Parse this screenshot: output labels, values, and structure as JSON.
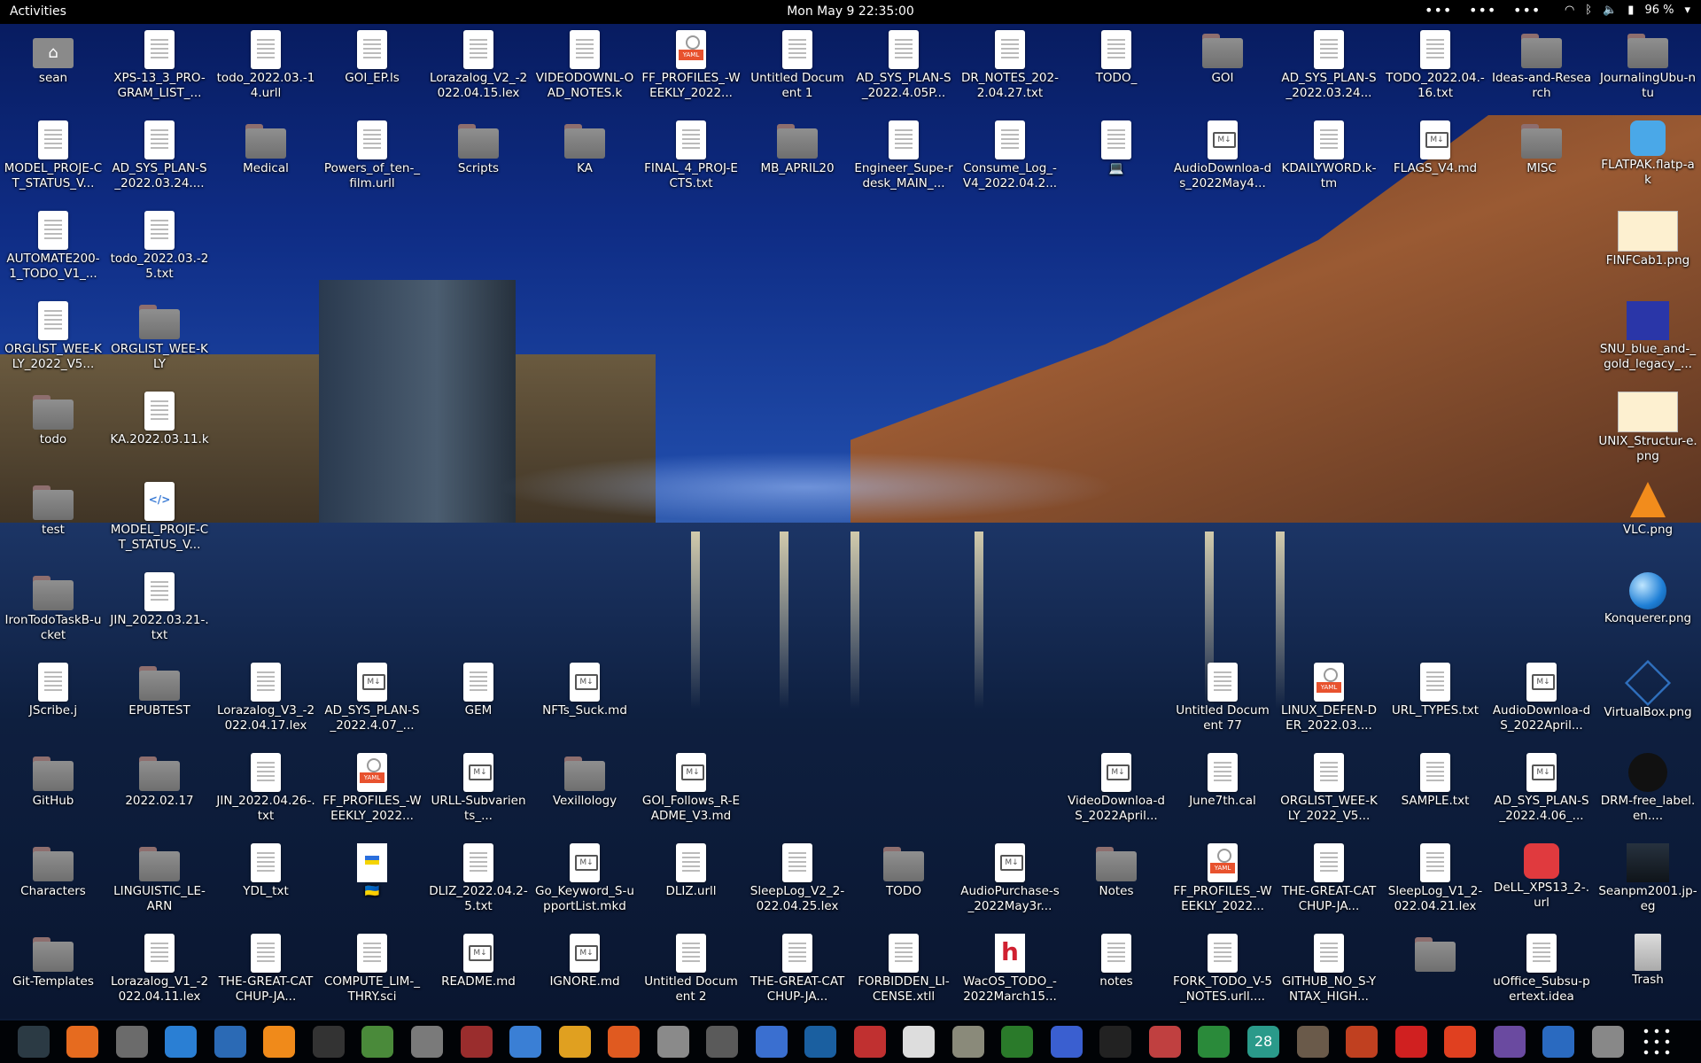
{
  "topbar": {
    "activities": "Activities",
    "clock": "Mon May 9  22:35:00",
    "battery": "96 %"
  },
  "desktop_icons": [
    {
      "id": "sean",
      "label": "sean",
      "kind": "home"
    },
    {
      "id": "xps",
      "label": "XPS-13_3_PRO-GRAM_LIST_...",
      "kind": "doc"
    },
    {
      "id": "todo1",
      "label": "todo_2022.03.-14.urll",
      "kind": "doc"
    },
    {
      "id": "goiep",
      "label": "GOI_EP.ls",
      "kind": "doc"
    },
    {
      "id": "lorav2",
      "label": "Lorazalog_V2_-2022.04.15.lex",
      "kind": "doc"
    },
    {
      "id": "videodl",
      "label": "VIDEODOWNL-OAD_NOTES.k",
      "kind": "doc"
    },
    {
      "id": "ffprof1",
      "label": "FF_PROFILES_-WEEKLY_2022...",
      "kind": "yaml"
    },
    {
      "id": "untitled1",
      "label": "Untitled Document 1",
      "kind": "doc"
    },
    {
      "id": "adsys1",
      "label": "AD_SYS_PLAN-S_2022.4.05P...",
      "kind": "doc"
    },
    {
      "id": "drnotes",
      "label": "DR_NOTES_202-2.04.27.txt",
      "kind": "doc"
    },
    {
      "id": "todo_",
      "label": "TODO_",
      "kind": "doc"
    },
    {
      "id": "goi",
      "label": "GOI",
      "kind": "folder"
    },
    {
      "id": "adsys2",
      "label": "AD_SYS_PLAN-S_2022.03.24...",
      "kind": "doc"
    },
    {
      "id": "todo2",
      "label": "TODO_2022.04.-16.txt",
      "kind": "doc"
    },
    {
      "id": "ideas",
      "label": "Ideas-and-Research",
      "kind": "folder"
    },
    {
      "id": "journal",
      "label": "JournalingUbu-ntu",
      "kind": "folder"
    },
    {
      "id": "model1",
      "label": "MODEL_PROJE-CT_STATUS_V...",
      "kind": "doc"
    },
    {
      "id": "adsys3",
      "label": "AD_SYS_PLAN-S_2022.03.24....",
      "kind": "doc"
    },
    {
      "id": "medical",
      "label": "Medical",
      "kind": "folder"
    },
    {
      "id": "powers",
      "label": "Powers_of_ten-_film.urll",
      "kind": "doc"
    },
    {
      "id": "scripts",
      "label": "Scripts",
      "kind": "folder"
    },
    {
      "id": "ka",
      "label": "KA",
      "kind": "folder"
    },
    {
      "id": "final4",
      "label": "FINAL_4_PROJ-ECTS.txt",
      "kind": "doc"
    },
    {
      "id": "mbapril",
      "label": "MB_APRIL20",
      "kind": "folder"
    },
    {
      "id": "engineer",
      "label": "Engineer_Supe-rdesk_MAIN_...",
      "kind": "doc"
    },
    {
      "id": "consume",
      "label": "Consume_Log_-V4_2022.04.2...",
      "kind": "doc"
    },
    {
      "id": "laptop",
      "label": "💻",
      "kind": "doc"
    },
    {
      "id": "audiodl1",
      "label": "AudioDownloa-ds_2022May4...",
      "kind": "md"
    },
    {
      "id": "kdaily",
      "label": "KDAILYWORD.k-tm",
      "kind": "doc"
    },
    {
      "id": "flags",
      "label": "FLAGS_V4.md",
      "kind": "md"
    },
    {
      "id": "misc",
      "label": "MISC",
      "kind": "folder"
    },
    {
      "id": "flatpak",
      "label": "FLATPAK.flatp-ak",
      "kind": "blue"
    },
    {
      "id": "automate",
      "label": "AUTOMATE200-1_TODO_V1_...",
      "kind": "doc"
    },
    {
      "id": "todo3",
      "label": "todo_2022.03.-25.txt",
      "kind": "doc"
    },
    {
      "id": "finfcab",
      "label": "FINFCab1.png",
      "kind": "image"
    },
    {
      "id": "orglist1",
      "label": "ORGLIST_WEE-KLY_2022_V5...",
      "kind": "doc"
    },
    {
      "id": "orglist2",
      "label": "ORGLIST_WEE-KLY",
      "kind": "folder"
    },
    {
      "id": "snu",
      "label": "SNU_blue_and-_gold_legacy_...",
      "kind": "snu"
    },
    {
      "id": "todofolder",
      "label": "todo",
      "kind": "folder"
    },
    {
      "id": "ka2",
      "label": "KA.2022.03.11.k",
      "kind": "doc"
    },
    {
      "id": "unix",
      "label": "UNIX_Structur-e.png",
      "kind": "image"
    },
    {
      "id": "test",
      "label": "test",
      "kind": "folder"
    },
    {
      "id": "model2",
      "label": "MODEL_PROJE-CT_STATUS_V...",
      "kind": "xml"
    },
    {
      "id": "vlc",
      "label": "VLC.png",
      "kind": "cone"
    },
    {
      "id": "irontodo",
      "label": "IronTodoTaskB-ucket",
      "kind": "folder"
    },
    {
      "id": "jin1",
      "label": "JIN_2022.03.21-.txt",
      "kind": "doc"
    },
    {
      "id": "konq",
      "label": "Konquerer.png",
      "kind": "globe"
    },
    {
      "id": "jscribe",
      "label": "JScribe.j",
      "kind": "doc"
    },
    {
      "id": "epubtest",
      "label": "EPUBTEST",
      "kind": "folder"
    },
    {
      "id": "lorav3",
      "label": "Lorazalog_V3_-2022.04.17.lex",
      "kind": "doc"
    },
    {
      "id": "adsys4",
      "label": "AD_SYS_PLAN-S_2022.4.07_...",
      "kind": "md"
    },
    {
      "id": "gem",
      "label": "GEM",
      "kind": "doc"
    },
    {
      "id": "nfts",
      "label": "NFTs_Suck.md",
      "kind": "md"
    },
    {
      "id": "untitled77",
      "label": "Untitled Document 77",
      "kind": "doc"
    },
    {
      "id": "linuxdef",
      "label": "LINUX_DEFEN-DER_2022.03....",
      "kind": "yaml"
    },
    {
      "id": "urltypes",
      "label": "URL_TYPES.txt",
      "kind": "doc"
    },
    {
      "id": "audiodl2",
      "label": "AudioDownloa-dS_2022April...",
      "kind": "md"
    },
    {
      "id": "vbox",
      "label": "VirtualBox.png",
      "kind": "vbox"
    },
    {
      "id": "github",
      "label": "GitHub",
      "kind": "folder"
    },
    {
      "id": "d20220217",
      "label": "2022.02.17",
      "kind": "folder"
    },
    {
      "id": "jin2",
      "label": "JIN_2022.04.26-.txt",
      "kind": "doc"
    },
    {
      "id": "ffprof2",
      "label": "FF_PROFILES_-WEEKLY_2022...",
      "kind": "yaml"
    },
    {
      "id": "urll",
      "label": "URLL-Subvarients_...",
      "kind": "md"
    },
    {
      "id": "vexil",
      "label": "Vexillology",
      "kind": "folder"
    },
    {
      "id": "goifollows",
      "label": "GOI_Follows_R-EADME_V3.md",
      "kind": "md"
    },
    {
      "id": "videodl2",
      "label": "VideoDownloa-dS_2022April...",
      "kind": "md"
    },
    {
      "id": "june7",
      "label": "June7th.cal",
      "kind": "doc"
    },
    {
      "id": "orglist3",
      "label": "ORGLIST_WEE-KLY_2022_V5...",
      "kind": "doc"
    },
    {
      "id": "sample",
      "label": "SAMPLE.txt",
      "kind": "doc"
    },
    {
      "id": "adsys5",
      "label": "AD_SYS_PLAN-S_2022.4.06_...",
      "kind": "md"
    },
    {
      "id": "drm",
      "label": "DRM-free_label.en....",
      "kind": "drm"
    },
    {
      "id": "characters",
      "label": "Characters",
      "kind": "folder"
    },
    {
      "id": "linguistic",
      "label": "LINGUISTIC_LE-ARN",
      "kind": "folder"
    },
    {
      "id": "ydl",
      "label": "YDL_txt",
      "kind": "doc"
    },
    {
      "id": "ukraine",
      "label": "🇺🇦",
      "kind": "sunflower"
    },
    {
      "id": "dliz1",
      "label": "DLIZ_2022.04.2-5.txt",
      "kind": "doc"
    },
    {
      "id": "gokeyword",
      "label": "Go_Keyword_S-upportList.mkd",
      "kind": "md"
    },
    {
      "id": "dlizurll",
      "label": "DLIZ.urll",
      "kind": "doc"
    },
    {
      "id": "sleepv2",
      "label": "SleepLog_V2_2-022.04.25.lex",
      "kind": "doc"
    },
    {
      "id": "todofolder2",
      "label": "TODO",
      "kind": "folder"
    },
    {
      "id": "audiopurch",
      "label": "AudioPurchase-s_2022May3r...",
      "kind": "md"
    },
    {
      "id": "notesfolder",
      "label": "Notes",
      "kind": "folder"
    },
    {
      "id": "ffprof3",
      "label": "FF_PROFILES_-WEEKLY_2022...",
      "kind": "yaml"
    },
    {
      "id": "greatcatch1",
      "label": "THE-GREAT-CATCHUP-JA...",
      "kind": "doc"
    },
    {
      "id": "sleepv1",
      "label": "SleepLog_V1_2-022.04.21.lex",
      "kind": "doc"
    },
    {
      "id": "dellxps",
      "label": "DeLL_XPS13_2-.url",
      "kind": "red"
    },
    {
      "id": "seanpm",
      "label": "Seanpm2001.jp-eg",
      "kind": "photo"
    },
    {
      "id": "gittemplates",
      "label": "Git-Templates",
      "kind": "folder"
    },
    {
      "id": "lorav1",
      "label": "Lorazalog_V1_-2022.04.11.lex",
      "kind": "doc"
    },
    {
      "id": "greatcatch2",
      "label": "THE-GREAT-CATCHUP-JA...",
      "kind": "doc"
    },
    {
      "id": "compute",
      "label": "COMPUTE_LIM-_THRY.sci",
      "kind": "doc"
    },
    {
      "id": "readme",
      "label": "README.md",
      "kind": "md"
    },
    {
      "id": "ignore",
      "label": "IGNORE.md",
      "kind": "md"
    },
    {
      "id": "untitled2",
      "label": "Untitled Document 2",
      "kind": "doc"
    },
    {
      "id": "greatcatch3",
      "label": "THE-GREAT-CATCHUP-JA...",
      "kind": "doc"
    },
    {
      "id": "forbidden",
      "label": "FORBIDDEN_LI-CENSE.xtll",
      "kind": "doc"
    },
    {
      "id": "wacos",
      "label": "WacOS_TODO_-2022March15...",
      "kind": "h"
    },
    {
      "id": "notes",
      "label": "notes",
      "kind": "doc"
    },
    {
      "id": "forktodo",
      "label": "FORK_TODO_V-5_NOTES.urll....",
      "kind": "doc"
    },
    {
      "id": "githubno",
      "label": "GITHUB_NO_S-YNTAX_HIGH...",
      "kind": "doc"
    },
    {
      "id": "pencilfolder",
      "label": "",
      "kind": "folder"
    },
    {
      "id": "uoffice",
      "label": "uOffice_Subsu-pertext.idea",
      "kind": "doc"
    },
    {
      "id": "trash",
      "label": "Trash",
      "kind": "trash"
    }
  ],
  "dock": {
    "apps": [
      {
        "name": "system-monitor",
        "color": "#2b3a44"
      },
      {
        "name": "firefox",
        "color": "#e66b1f"
      },
      {
        "name": "settings",
        "color": "#6b6b6b"
      },
      {
        "name": "help",
        "color": "#2a7fd4"
      },
      {
        "name": "writer",
        "color": "#2b6ab5"
      },
      {
        "name": "vlc",
        "color": "#f08a1a"
      },
      {
        "name": "terminal",
        "color": "#333333"
      },
      {
        "name": "gnome-mahjongg",
        "color": "#4a8a3a"
      },
      {
        "name": "image-viewer",
        "color": "#7a7a7a"
      },
      {
        "name": "monitor-graph",
        "color": "#9a2d2d"
      },
      {
        "name": "text-editor",
        "color": "#3a7fd5"
      },
      {
        "name": "calculator",
        "color": "#e0a020"
      },
      {
        "name": "software-center",
        "color": "#e05a20"
      },
      {
        "name": "files",
        "color": "#8a8a8a"
      },
      {
        "name": "disk-utility",
        "color": "#5a5a5a"
      },
      {
        "name": "todo",
        "color": "#3a6fd0"
      },
      {
        "name": "dictionary",
        "color": "#1a5fa0"
      },
      {
        "name": "document-scanner",
        "color": "#c03030"
      },
      {
        "name": "character-map",
        "color": "#dddddd"
      },
      {
        "name": "archive-manager",
        "color": "#8a8a7a"
      },
      {
        "name": "vim",
        "color": "#2a7a2a"
      },
      {
        "name": "screenshot",
        "color": "#3a5fd0"
      },
      {
        "name": "music",
        "color": "#222222"
      },
      {
        "name": "document-viewer",
        "color": "#c04040"
      },
      {
        "name": "calc",
        "color": "#2a8a3a"
      },
      {
        "name": "calendar",
        "color": "#2a9a8a"
      },
      {
        "name": "gimp",
        "color": "#6a5a4a"
      },
      {
        "name": "game",
        "color": "#c04020"
      },
      {
        "name": "alert",
        "color": "#d02020"
      },
      {
        "name": "update-manager",
        "color": "#e04020"
      },
      {
        "name": "recorder",
        "color": "#6a4aa0"
      },
      {
        "name": "network-tool",
        "color": "#2a6ac0"
      },
      {
        "name": "settings-2",
        "color": "#888888"
      },
      {
        "name": "show-apps",
        "color": "#000000"
      }
    ],
    "calendar_day": "28"
  }
}
